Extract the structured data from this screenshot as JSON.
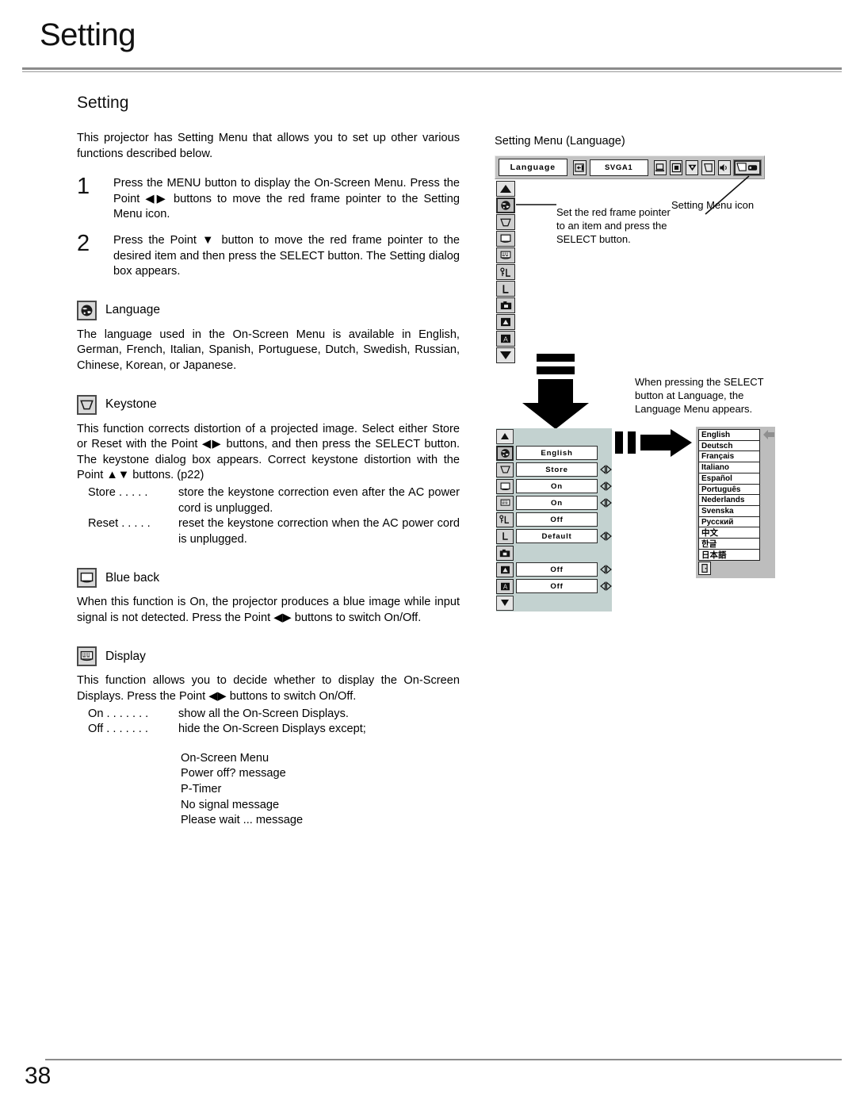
{
  "page": {
    "running_head": "Setting",
    "section_title": "Setting",
    "page_number": "38"
  },
  "intro": {
    "text": "This projector has Setting Menu that allows you to set up other various functions described below."
  },
  "steps": [
    {
      "number": "1",
      "text": "Press the MENU button to display the On-Screen Menu. Press the Point ◀▶ buttons to move the red frame pointer to the Setting Menu icon."
    },
    {
      "number": "2",
      "text": "Press the Point ▼ button to move the red frame pointer to the desired item and then press the SELECT button. The Setting dialog box appears."
    }
  ],
  "features": [
    {
      "icon": "globe-icon",
      "label": "Language",
      "body": "The language used in the On-Screen Menu is available in English, German, French, Italian, Spanish, Portuguese, Dutch, Swedish, Russian, Chinese, Korean, or Japanese."
    },
    {
      "icon": "keystone-icon",
      "label": "Keystone",
      "body": "This function corrects distortion of a projected image. Select either Store or Reset with the Point ◀▶ buttons, and then press the SELECT button. The keystone dialog box appears. Correct keystone distortion with the Point ▲▼ buttons. (p22)",
      "options": [
        {
          "key": "Store",
          "dots": ". . . . .",
          "value": "store the keystone correction even after the AC power cord is unplugged."
        },
        {
          "key": "Reset",
          "dots": ". . . . .",
          "value": "reset the keystone correction when the AC power cord is unplugged."
        }
      ]
    },
    {
      "icon": "blue-back-icon",
      "label": "Blue back",
      "body": "When this function is  On,  the projector produces a blue image while input signal is not detected. Press the Point ◀▶ buttons to switch On/Off."
    },
    {
      "icon": "display-icon",
      "label": "Display",
      "body": "This function allows you to decide whether to display the On-Screen Displays. Press the Point ◀▶ buttons to switch On/Off.",
      "options": [
        {
          "key": "On",
          "dots": ". . . . . . .",
          "value": "show all the On-Screen Displays."
        },
        {
          "key": "Off",
          "dots": ". . . . . . .",
          "value": "hide the On-Screen Displays except;"
        }
      ],
      "except_list": [
        "On-Screen Menu",
        " Power off?  message",
        "P-Timer",
        " No signal  message",
        " Please wait ...  message"
      ]
    }
  ],
  "diagram": {
    "caption": "Setting Menu (Language)",
    "osd_top": {
      "title": "Language",
      "input_label": "SVGA1",
      "icons": [
        "input-source-icon",
        "computer-menu-icon",
        "image-size-menu-icon",
        "color-adjust-menu-icon",
        "screen-menu-icon",
        "sound-menu-icon",
        "setting-menu-icon"
      ]
    },
    "strip_icons": [
      "scroll-up-icon",
      "globe-icon",
      "keystone-icon",
      "blue-back-icon",
      "display-icon",
      "logo-pin-icon",
      "lamp-mode-icon",
      "capture-icon",
      "ceiling-icon",
      "rear-icon",
      "scroll-down-icon"
    ],
    "annotation_pointer": "Set the red frame pointer to an item and press the SELECT button.",
    "annotation_setting_icon": "Setting Menu icon",
    "annotation_select": "When pressing the SELECT button at Language, the Language Menu appears.",
    "dialog_rows": [
      {
        "icon": "scroll-up-icon",
        "value": "",
        "adjust": false,
        "nav": true
      },
      {
        "icon": "globe-icon",
        "value": "English",
        "adjust": false,
        "selected": true
      },
      {
        "icon": "keystone-icon",
        "value": "Store",
        "adjust": true
      },
      {
        "icon": "blue-back-icon",
        "value": "On",
        "adjust": true
      },
      {
        "icon": "display-icon",
        "value": "On",
        "adjust": true
      },
      {
        "icon": "logo-pin-icon",
        "value": "Off",
        "adjust": false
      },
      {
        "icon": "lamp-mode-icon",
        "value": "Default",
        "adjust": true
      },
      {
        "icon": "capture-icon",
        "value": "",
        "adjust": false
      },
      {
        "icon": "ceiling-icon",
        "value": "Off",
        "adjust": true
      },
      {
        "icon": "rear-icon",
        "value": "Off",
        "adjust": true
      },
      {
        "icon": "scroll-down-icon",
        "value": "",
        "adjust": false,
        "nav": true
      }
    ],
    "languages": [
      "English",
      "Deutsch",
      "Français",
      "Italiano",
      "Español",
      "Português",
      "Nederlands",
      "Svenska",
      "Русский",
      "中文",
      "한글",
      "日本語"
    ],
    "language_exit_icon": "exit-door-icon"
  }
}
